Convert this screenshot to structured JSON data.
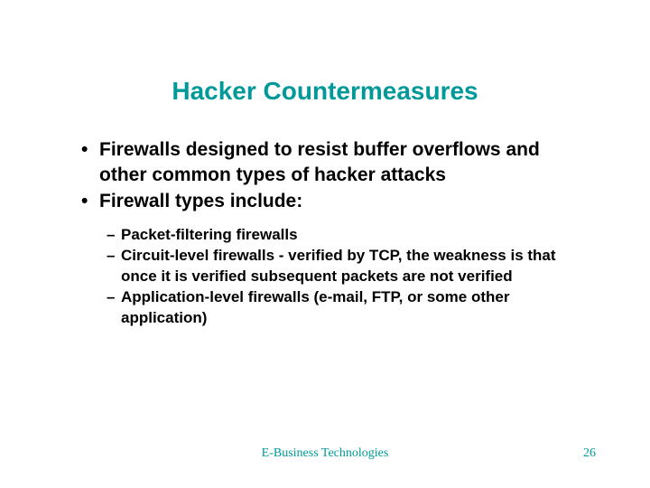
{
  "title": "Hacker Countermeasures",
  "bullets": {
    "main": [
      "Firewalls designed to resist buffer overflows and other common types of hacker attacks",
      "Firewall types include:"
    ],
    "sub": [
      "Packet-filtering firewalls",
      "Circuit-level firewalls - verified by TCP, the weakness is that once it is verified subsequent packets are not verified",
      "Application-level firewalls (e-mail, FTP, or some other application)"
    ]
  },
  "footer": {
    "center": "E-Business Technologies",
    "page": "26"
  }
}
